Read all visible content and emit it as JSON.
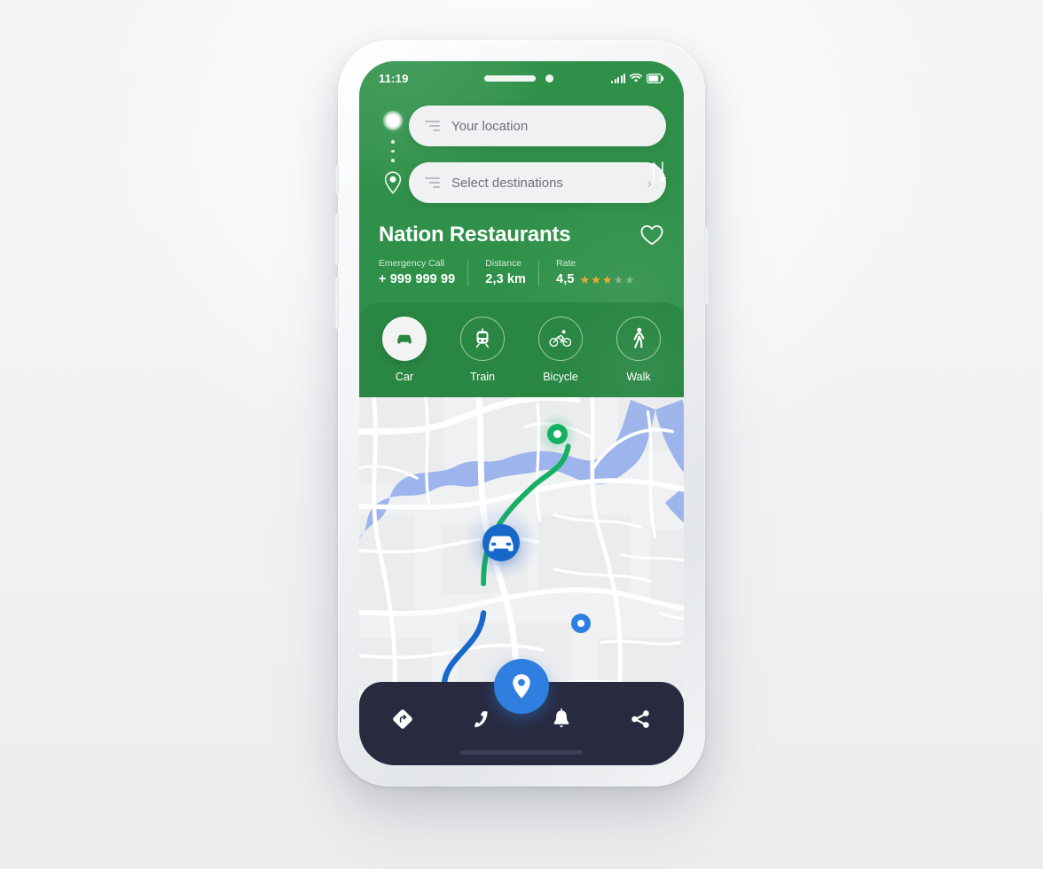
{
  "status_bar": {
    "time": "11:19",
    "signal_icon": "signal-bars-icon",
    "wifi_icon": "wifi-icon",
    "battery_icon": "battery-icon"
  },
  "search": {
    "origin": {
      "placeholder": "Your location",
      "value": "",
      "icon": "current-location-dot-icon",
      "lines_icon": "menu-lines-icon"
    },
    "destination": {
      "placeholder": "Select destinations",
      "value": "",
      "icon": "map-pin-outline-icon",
      "lines_icon": "menu-lines-icon",
      "chevron": "›"
    },
    "swap_icon": "swap-vertical-arrows-icon"
  },
  "place": {
    "title": "Nation Restaurants",
    "favorite_icon": "heart-outline-icon",
    "stats": [
      {
        "label": "Emergency Call",
        "value": "+ 999 999 99",
        "name": "emergency-call"
      },
      {
        "label": "Distance",
        "value": "2,3 km",
        "name": "distance"
      },
      {
        "label": "Rate",
        "value": "4,5",
        "name": "rate",
        "stars_filled": 3,
        "stars_total": 5
      }
    ]
  },
  "transport_modes": [
    {
      "label": "Car",
      "icon": "car-icon",
      "active": true
    },
    {
      "label": "Train",
      "icon": "train-icon",
      "active": false
    },
    {
      "label": "Bicycle",
      "icon": "bicycle-icon",
      "active": false
    },
    {
      "label": "Walk",
      "icon": "walk-icon",
      "active": false
    }
  ],
  "map": {
    "markers": [
      {
        "name": "destination-marker",
        "icon": "circle-marker-icon",
        "color": "#16b064"
      },
      {
        "name": "vehicle-marker",
        "icon": "car-icon",
        "color": "#1669c9"
      },
      {
        "name": "route-endpoint-marker",
        "icon": "circle-marker-icon",
        "color": "#2f7fe0"
      }
    ],
    "route_colors": {
      "upper": "#16b064",
      "lower": "#1669c9"
    },
    "water_color": "#9db4ec",
    "land_color": "#f0f1f2",
    "road_color": "#ffffff"
  },
  "bottom_nav": {
    "items": [
      {
        "name": "directions-sign-icon",
        "label": "Directions"
      },
      {
        "name": "phone-icon",
        "label": "Call"
      },
      {
        "name": "location-pin-icon",
        "label": "Navigate",
        "primary": true
      },
      {
        "name": "bell-icon",
        "label": "Notifications"
      },
      {
        "name": "share-icon",
        "label": "Share"
      }
    ],
    "background_color": "#282b40",
    "fab_color": "#2f7fe0"
  },
  "theme": {
    "green_primary": "#2f9149",
    "green_dark": "#2a8743",
    "star_on": "#f0a830",
    "star_off": "#7fb98d",
    "field_bg": "#f0f1f2",
    "page_bg": "#f2f3f4"
  }
}
